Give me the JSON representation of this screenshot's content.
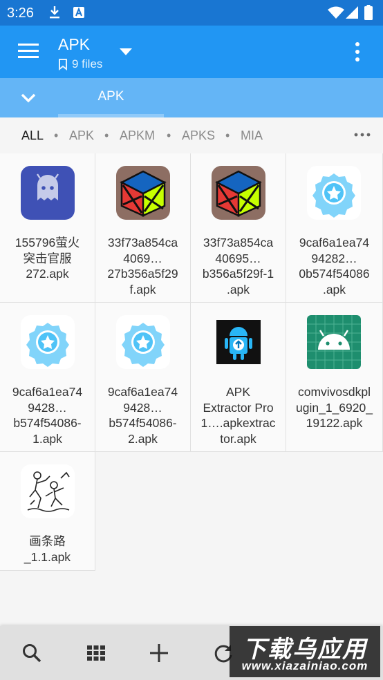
{
  "status_bar": {
    "time": "3:26"
  },
  "header": {
    "title": "APK",
    "subtitle": "9 files"
  },
  "tabs": [
    {
      "label": "APK"
    }
  ],
  "filters": [
    "ALL",
    "APK",
    "APKM",
    "APKS",
    "MIA"
  ],
  "files": [
    {
      "lines": [
        "155796萤火",
        "突击官服",
        "272.apk"
      ],
      "icon": "android-ghost-app-icon"
    },
    {
      "lines": [
        "33f73a854ca",
        "4069…",
        "27b356a5f29",
        "f.apk"
      ],
      "icon": "rubiks-cube-icon"
    },
    {
      "lines": [
        "33f73a854ca",
        "40695…",
        "b356a5f29f-1",
        ".apk"
      ],
      "icon": "rubiks-cube-icon"
    },
    {
      "lines": [
        "9caf6a1ea74",
        "94282…",
        "0b574f54086",
        ".apk"
      ],
      "icon": "badge-star-icon"
    },
    {
      "lines": [
        "9caf6a1ea74",
        "9428…",
        "b574f54086-",
        "1.apk"
      ],
      "icon": "badge-star-icon"
    },
    {
      "lines": [
        "9caf6a1ea74",
        "9428…",
        "b574f54086-",
        "2.apk"
      ],
      "icon": "badge-star-icon"
    },
    {
      "lines": [
        "APK",
        "Extractor Pro",
        "1….apkextrac",
        "tor.apk"
      ],
      "icon": "apk-extractor-icon"
    },
    {
      "lines": [
        "comvivosdkpl",
        "ugin_1_6920_",
        "19122.apk"
      ],
      "icon": "android-robot-icon"
    },
    {
      "lines": [
        "画条路",
        "_1.1.apk"
      ],
      "icon": "sketch-drawing-icon"
    }
  ],
  "watermark": {
    "big": "下载乌应用",
    "small": "www.xiazainiao.com"
  },
  "colors": {
    "status_bar": "#1976d2",
    "app_bar": "#2196f3",
    "tab_row": "#64b5f6",
    "bottom_bar": "#e0e0e0"
  }
}
